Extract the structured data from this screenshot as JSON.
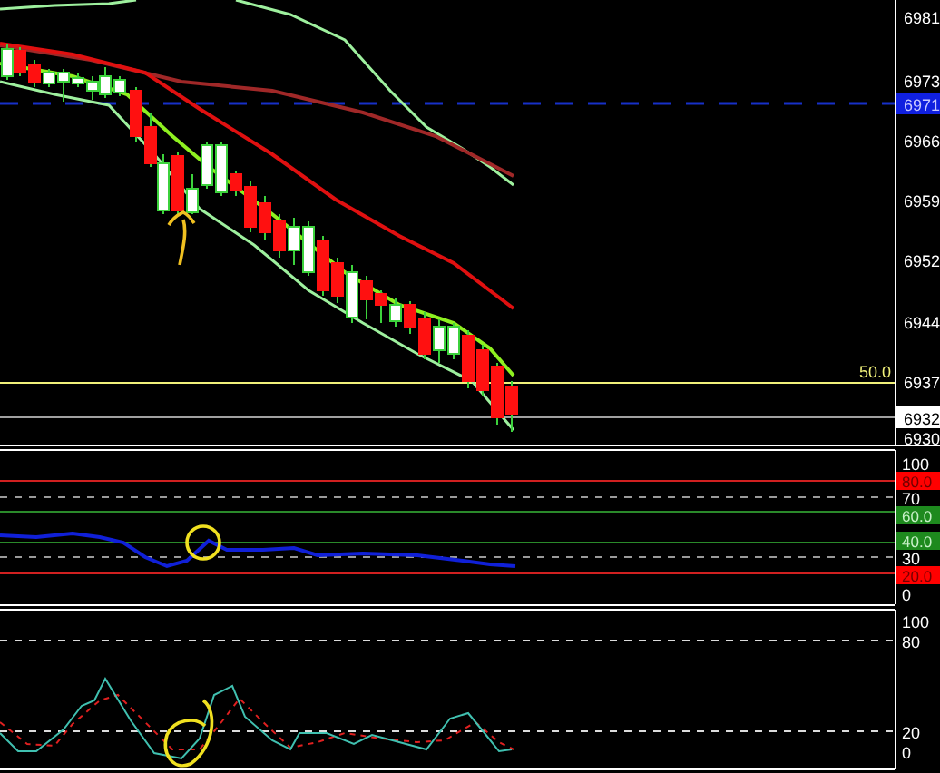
{
  "price_panel": {
    "axis_labels": [
      "6981",
      "6973",
      "6966",
      "6959",
      "6952",
      "6944",
      "6937",
      "6930"
    ],
    "price_tag": "6971",
    "last_price": "6932",
    "level_label": "50.0"
  },
  "rsi_panel": {
    "axis_labels": [
      "100",
      "70",
      "30",
      "0"
    ],
    "level_tags": [
      {
        "label": "80.0",
        "color": "#ff0000"
      },
      {
        "label": "60.0",
        "color": "#1e8a1e"
      },
      {
        "label": "40.0",
        "color": "#1e8a1e"
      },
      {
        "label": "20.0",
        "color": "#ff0000"
      }
    ]
  },
  "stochastic_panel": {
    "axis_labels": [
      "100",
      "80",
      "20",
      "0"
    ]
  }
}
